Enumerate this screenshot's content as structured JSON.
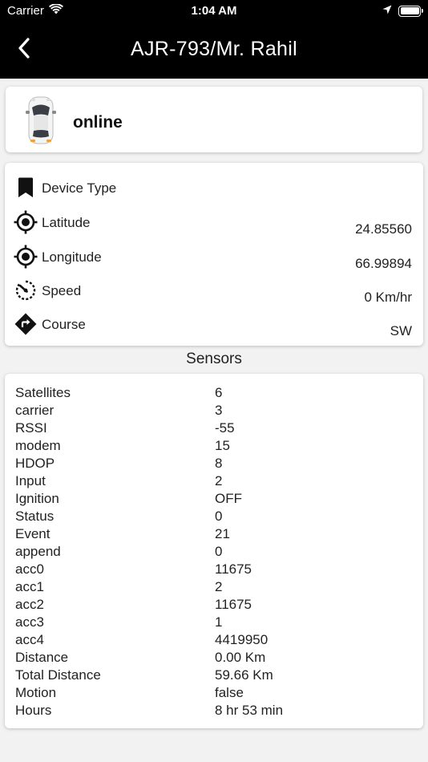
{
  "status_bar": {
    "carrier": "Carrier",
    "time": "1:04 AM"
  },
  "header": {
    "title": "AJR-793/Mr. Rahil"
  },
  "vehicle": {
    "status": "online"
  },
  "info": {
    "device_type_label": "Device Type",
    "latitude_label": "Latitude",
    "latitude_value": "24.85560",
    "longitude_label": "Longitude",
    "longitude_value": "66.99894",
    "speed_label": "Speed",
    "speed_value": "0 Km/hr",
    "course_label": "Course",
    "course_value": "SW"
  },
  "sensors": {
    "title": "Sensors",
    "rows": [
      {
        "name": "Satellites",
        "value": "6"
      },
      {
        "name": "carrier",
        "value": "3"
      },
      {
        "name": "RSSI",
        "value": "-55"
      },
      {
        "name": "modem",
        "value": "15"
      },
      {
        "name": "HDOP",
        "value": "8"
      },
      {
        "name": "Input",
        "value": "2"
      },
      {
        "name": "Ignition",
        "value": "OFF"
      },
      {
        "name": "Status",
        "value": "0"
      },
      {
        "name": "Event",
        "value": "21"
      },
      {
        "name": "append",
        "value": "0"
      },
      {
        "name": "acc0",
        "value": "11675"
      },
      {
        "name": "acc1",
        "value": "2"
      },
      {
        "name": "acc2",
        "value": "11675"
      },
      {
        "name": "acc3",
        "value": "1"
      },
      {
        "name": "acc4",
        "value": "4419950"
      },
      {
        "name": "Distance",
        "value": "0.00 Km"
      },
      {
        "name": "Total Distance",
        "value": "59.66 Km"
      },
      {
        "name": "Motion",
        "value": "false"
      },
      {
        "name": "Hours",
        "value": "8 hr 53 min"
      }
    ]
  },
  "icons": {
    "back": "chevron-left-icon",
    "device_type": "bookmark-icon",
    "latitude": "gps-fixed-icon",
    "longitude": "gps-fixed-icon",
    "speed": "speedometer-icon",
    "course": "turn-right-icon",
    "vehicle": "car-top-view-icon"
  },
  "colors": {
    "header_bg": "#000000",
    "page_bg": "#f2f2f2",
    "card_bg": "#ffffff"
  }
}
